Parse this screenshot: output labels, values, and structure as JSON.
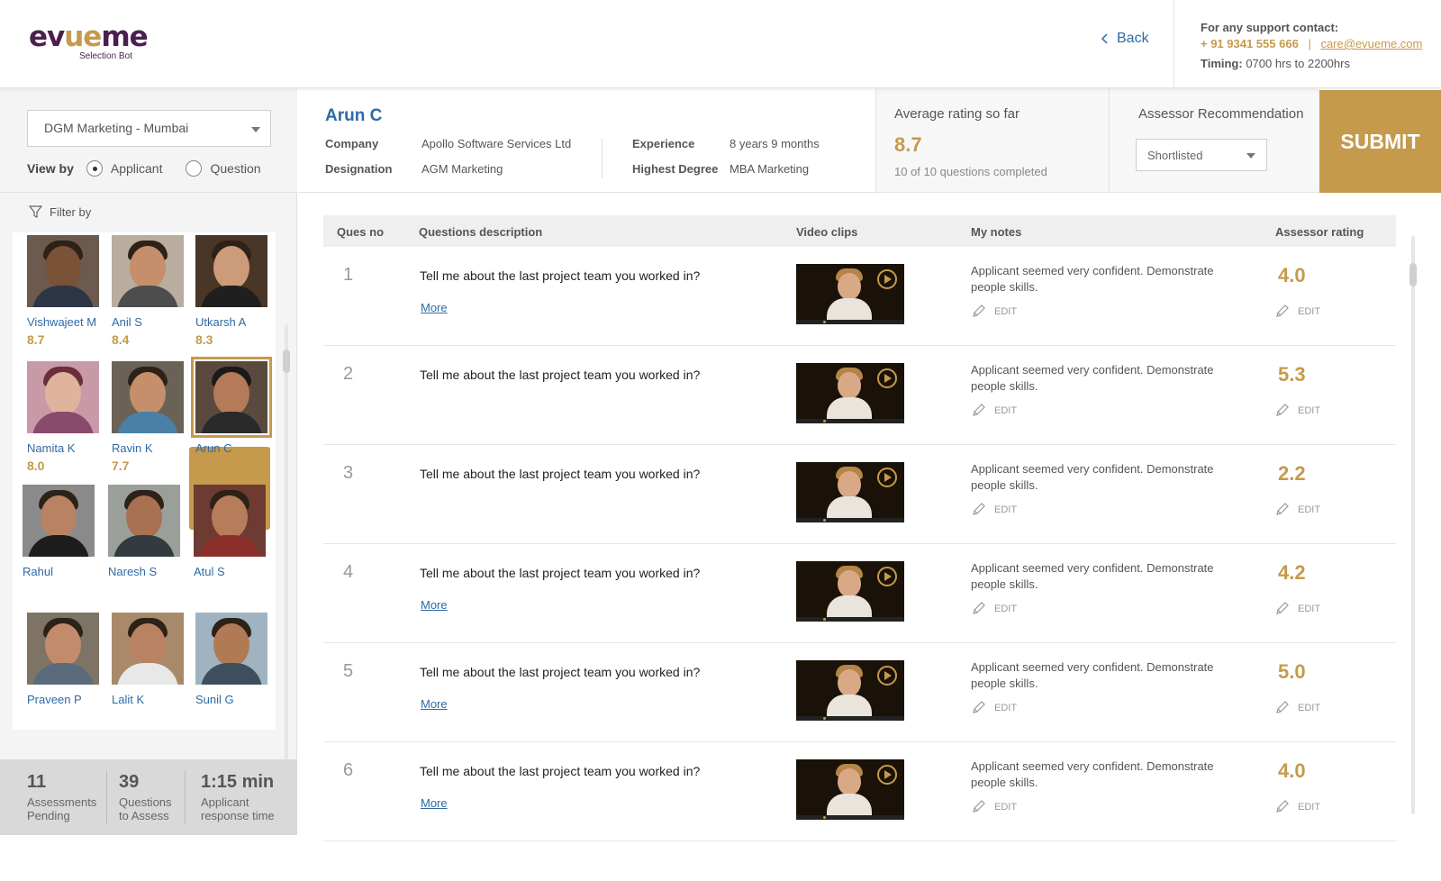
{
  "header": {
    "logo_text_a": "ev",
    "logo_text_b": "ue",
    "logo_text_c": "me",
    "logo_sub": "Selection Bot",
    "back_label": "Back",
    "support_title": "For any support contact:",
    "support_phone": "+ 91 9341 555 666",
    "support_sep": "|",
    "support_email": "care@evueme.com",
    "timing_label": "Timing:",
    "timing_value": "0700 hrs to  2200hrs"
  },
  "filters": {
    "job_select": "DGM Marketing - Mumbai",
    "view_by_label": "View by",
    "view_options": [
      "Applicant",
      "Question"
    ],
    "selected_view": "Applicant",
    "filter_label": "Filter by"
  },
  "applicants": [
    {
      "name": "Vishwajeet M",
      "score": "8.7"
    },
    {
      "name": "Anil S",
      "score": "8.4"
    },
    {
      "name": "Utkarsh A",
      "score": "8.3"
    },
    {
      "name": "Namita K",
      "score": "8.0"
    },
    {
      "name": "Ravin K",
      "score": "7.7"
    },
    {
      "name": "Arun C",
      "score": ""
    },
    {
      "name": "Rahul",
      "score": ""
    },
    {
      "name": "Naresh S",
      "score": ""
    },
    {
      "name": "Atul S",
      "score": ""
    },
    {
      "name": "Praveen P",
      "score": ""
    },
    {
      "name": "Lalit K",
      "score": ""
    },
    {
      "name": "Sunil G",
      "score": ""
    }
  ],
  "stats": [
    {
      "num": "11",
      "label1": "Assessments",
      "label2": "Pending"
    },
    {
      "num": "39",
      "label1": "Questions",
      "label2": "to Assess"
    },
    {
      "num": "1:15 min",
      "label1": "Applicant",
      "label2": "response time"
    }
  ],
  "candidate": {
    "name": "Arun C",
    "company_label": "Company",
    "company": "Apollo Software Services Ltd",
    "designation_label": "Designation",
    "designation": "AGM Marketing",
    "experience_label": "Experience",
    "experience": "8 years 9 months",
    "degree_label": "Highest Degree",
    "degree": "MBA Marketing"
  },
  "average": {
    "title": "Average rating so far",
    "value": "8.7",
    "sub": "10 of 10 questions completed"
  },
  "recommendation": {
    "title": "Assessor Recommendation",
    "value": "Shortlisted"
  },
  "submit_label": "SUBMIT",
  "table": {
    "headers": [
      "Ques no",
      "Questions description",
      "Video clips",
      "My notes",
      "Assessor rating"
    ],
    "more_label": "More",
    "edit_label": "EDIT",
    "rows": [
      {
        "no": "1",
        "question": "Tell me about the last project team you worked in?",
        "more": true,
        "note": "Applicant seemed very confident. Demonstrate people skills.",
        "rating": "4.0"
      },
      {
        "no": "2",
        "question": "Tell me about the last project team you worked in?",
        "more": false,
        "note": "Applicant seemed very confident. Demonstrate people skills.",
        "rating": "5.3"
      },
      {
        "no": "3",
        "question": "Tell me about the last project team you worked in?",
        "more": false,
        "note": "Applicant seemed very confident. Demonstrate people skills.",
        "rating": "2.2"
      },
      {
        "no": "4",
        "question": "Tell me about the last project team you worked in?",
        "more": true,
        "note": "Applicant seemed very confident. Demonstrate people skills.",
        "rating": "4.2"
      },
      {
        "no": "5",
        "question": "Tell me about the last project team you worked in?",
        "more": true,
        "note": "Applicant seemed very confident. Demonstrate people skills.",
        "rating": "5.0"
      },
      {
        "no": "6",
        "question": "Tell me about the last project team you worked in?",
        "more": true,
        "note": "Applicant seemed very confident. Demonstrate people skills.",
        "rating": "4.0"
      }
    ]
  },
  "colors": {
    "gold": "#c59a4c",
    "link_blue": "#2e6aa6",
    "brand_purple": "#4a1f4f"
  }
}
